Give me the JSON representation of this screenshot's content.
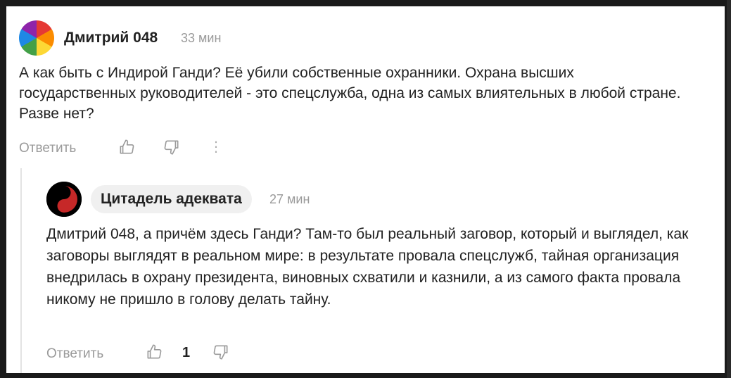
{
  "comment1": {
    "author": "Дмитрий 048",
    "time": "33 мин",
    "text": "А как быть с Индирой Ганди? Её убили собственные охранники. Охрана высших государственных руководителей - это спецслужба, одна из самых влиятельных в любой стране. Разве нет?",
    "reply_label": "Ответить",
    "more_glyph": "⋮",
    "avatar_icon": "colorful-circle-avatar"
  },
  "comment2": {
    "author": "Цитадель адеквата",
    "time": "27 мин",
    "text": "Дмитрий 048, а причём здесь Ганди? Там-то был реальный заговор, который и выглядел, как заговоры выглядят в реальном мире: в результате провала спецслужб, тайная организация внедрилась в охрану президента, виновных схватили и казнили, а из самого факта провала никому не пришло в голову делать тайну.",
    "reply_label": "Ответить",
    "like_count": "1",
    "avatar_icon": "yin-yang-avatar"
  },
  "colors": {
    "text": "#222222",
    "muted": "#9a9a9a",
    "pill_bg": "#f0f0f0"
  }
}
